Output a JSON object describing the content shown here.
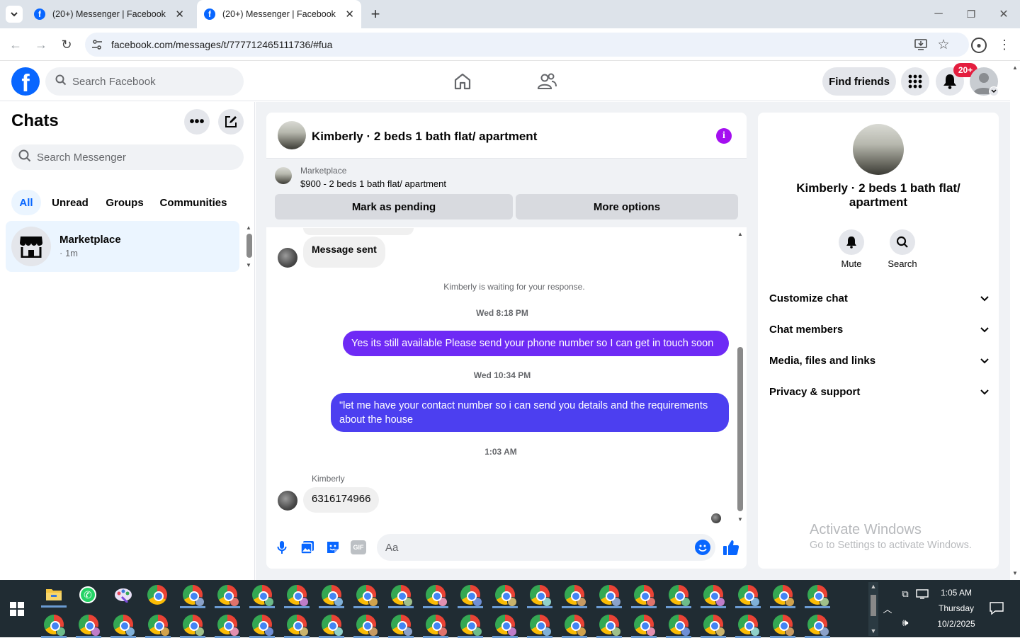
{
  "browser": {
    "tabs": [
      {
        "title": "(20+) Messenger | Facebook",
        "active": false
      },
      {
        "title": "(20+) Messenger | Facebook",
        "active": true
      }
    ],
    "url": "facebook.com/messages/t/777712465111736/#fua"
  },
  "fb_header": {
    "search_placeholder": "Search Facebook",
    "find_friends": "Find friends",
    "notif_badge": "20+"
  },
  "chats_panel": {
    "title": "Chats",
    "search_placeholder": "Search Messenger",
    "filters": [
      "All",
      "Unread",
      "Groups",
      "Communities"
    ],
    "items": [
      {
        "name": "Marketplace",
        "meta": "· 1m"
      }
    ]
  },
  "conversation": {
    "title": "Kimberly · 2 beds 1 bath flat/ apartment",
    "listing_source": "Marketplace",
    "listing_title": "$900 - 2 beds 1 bath flat/ apartment",
    "mark_pending": "Mark as pending",
    "more_options": "More options",
    "messages": {
      "sent_notice": "Message sent",
      "waiting": "Kimberly is waiting for your response.",
      "ts1": "Wed 8:18 PM",
      "out1": "Yes its still available Please send your phone number so I can get in touch soon",
      "ts2": "Wed 10:34 PM",
      "out2": "\"let me have your contact number so i can send you details and the requirements about the house",
      "ts3": "1:03 AM",
      "sender": "Kimberly",
      "in1": "6316174966"
    },
    "composer_placeholder": "Aa",
    "colors": {
      "out1": "#6e2af5",
      "out2": "#4c3ff0",
      "fb_blue": "#0866ff"
    }
  },
  "info_panel": {
    "name": "Kimberly · 2 beds 1 bath flat/ apartment",
    "mute": "Mute",
    "search": "Search",
    "sections": [
      "Customize chat",
      "Chat members",
      "Media, files and links",
      "Privacy & support"
    ]
  },
  "watermark": {
    "line1": "Activate Windows",
    "line2": "Go to Settings to activate Windows."
  },
  "taskbar": {
    "time": "1:05 AM",
    "day": "Thursday",
    "date": "10/2/2025"
  }
}
